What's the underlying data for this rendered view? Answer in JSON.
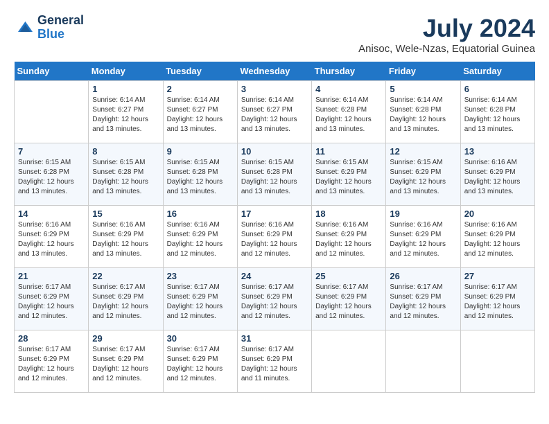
{
  "header": {
    "logo": {
      "general": "General",
      "blue": "Blue"
    },
    "title": "July 2024",
    "location": "Anisoc, Wele-Nzas, Equatorial Guinea"
  },
  "calendar": {
    "weekdays": [
      "Sunday",
      "Monday",
      "Tuesday",
      "Wednesday",
      "Thursday",
      "Friday",
      "Saturday"
    ],
    "weeks": [
      [
        {
          "day": "",
          "info": ""
        },
        {
          "day": "1",
          "info": "Sunrise: 6:14 AM\nSunset: 6:27 PM\nDaylight: 12 hours\nand 13 minutes."
        },
        {
          "day": "2",
          "info": "Sunrise: 6:14 AM\nSunset: 6:27 PM\nDaylight: 12 hours\nand 13 minutes."
        },
        {
          "day": "3",
          "info": "Sunrise: 6:14 AM\nSunset: 6:27 PM\nDaylight: 12 hours\nand 13 minutes."
        },
        {
          "day": "4",
          "info": "Sunrise: 6:14 AM\nSunset: 6:28 PM\nDaylight: 12 hours\nand 13 minutes."
        },
        {
          "day": "5",
          "info": "Sunrise: 6:14 AM\nSunset: 6:28 PM\nDaylight: 12 hours\nand 13 minutes."
        },
        {
          "day": "6",
          "info": "Sunrise: 6:14 AM\nSunset: 6:28 PM\nDaylight: 12 hours\nand 13 minutes."
        }
      ],
      [
        {
          "day": "7",
          "info": "Sunrise: 6:15 AM\nSunset: 6:28 PM\nDaylight: 12 hours\nand 13 minutes."
        },
        {
          "day": "8",
          "info": "Sunrise: 6:15 AM\nSunset: 6:28 PM\nDaylight: 12 hours\nand 13 minutes."
        },
        {
          "day": "9",
          "info": "Sunrise: 6:15 AM\nSunset: 6:28 PM\nDaylight: 12 hours\nand 13 minutes."
        },
        {
          "day": "10",
          "info": "Sunrise: 6:15 AM\nSunset: 6:28 PM\nDaylight: 12 hours\nand 13 minutes."
        },
        {
          "day": "11",
          "info": "Sunrise: 6:15 AM\nSunset: 6:29 PM\nDaylight: 12 hours\nand 13 minutes."
        },
        {
          "day": "12",
          "info": "Sunrise: 6:15 AM\nSunset: 6:29 PM\nDaylight: 12 hours\nand 13 minutes."
        },
        {
          "day": "13",
          "info": "Sunrise: 6:16 AM\nSunset: 6:29 PM\nDaylight: 12 hours\nand 13 minutes."
        }
      ],
      [
        {
          "day": "14",
          "info": "Sunrise: 6:16 AM\nSunset: 6:29 PM\nDaylight: 12 hours\nand 13 minutes."
        },
        {
          "day": "15",
          "info": "Sunrise: 6:16 AM\nSunset: 6:29 PM\nDaylight: 12 hours\nand 13 minutes."
        },
        {
          "day": "16",
          "info": "Sunrise: 6:16 AM\nSunset: 6:29 PM\nDaylight: 12 hours\nand 12 minutes."
        },
        {
          "day": "17",
          "info": "Sunrise: 6:16 AM\nSunset: 6:29 PM\nDaylight: 12 hours\nand 12 minutes."
        },
        {
          "day": "18",
          "info": "Sunrise: 6:16 AM\nSunset: 6:29 PM\nDaylight: 12 hours\nand 12 minutes."
        },
        {
          "day": "19",
          "info": "Sunrise: 6:16 AM\nSunset: 6:29 PM\nDaylight: 12 hours\nand 12 minutes."
        },
        {
          "day": "20",
          "info": "Sunrise: 6:16 AM\nSunset: 6:29 PM\nDaylight: 12 hours\nand 12 minutes."
        }
      ],
      [
        {
          "day": "21",
          "info": "Sunrise: 6:17 AM\nSunset: 6:29 PM\nDaylight: 12 hours\nand 12 minutes."
        },
        {
          "day": "22",
          "info": "Sunrise: 6:17 AM\nSunset: 6:29 PM\nDaylight: 12 hours\nand 12 minutes."
        },
        {
          "day": "23",
          "info": "Sunrise: 6:17 AM\nSunset: 6:29 PM\nDaylight: 12 hours\nand 12 minutes."
        },
        {
          "day": "24",
          "info": "Sunrise: 6:17 AM\nSunset: 6:29 PM\nDaylight: 12 hours\nand 12 minutes."
        },
        {
          "day": "25",
          "info": "Sunrise: 6:17 AM\nSunset: 6:29 PM\nDaylight: 12 hours\nand 12 minutes."
        },
        {
          "day": "26",
          "info": "Sunrise: 6:17 AM\nSunset: 6:29 PM\nDaylight: 12 hours\nand 12 minutes."
        },
        {
          "day": "27",
          "info": "Sunrise: 6:17 AM\nSunset: 6:29 PM\nDaylight: 12 hours\nand 12 minutes."
        }
      ],
      [
        {
          "day": "28",
          "info": "Sunrise: 6:17 AM\nSunset: 6:29 PM\nDaylight: 12 hours\nand 12 minutes."
        },
        {
          "day": "29",
          "info": "Sunrise: 6:17 AM\nSunset: 6:29 PM\nDaylight: 12 hours\nand 12 minutes."
        },
        {
          "day": "30",
          "info": "Sunrise: 6:17 AM\nSunset: 6:29 PM\nDaylight: 12 hours\nand 12 minutes."
        },
        {
          "day": "31",
          "info": "Sunrise: 6:17 AM\nSunset: 6:29 PM\nDaylight: 12 hours\nand 11 minutes."
        },
        {
          "day": "",
          "info": ""
        },
        {
          "day": "",
          "info": ""
        },
        {
          "day": "",
          "info": ""
        }
      ]
    ]
  }
}
